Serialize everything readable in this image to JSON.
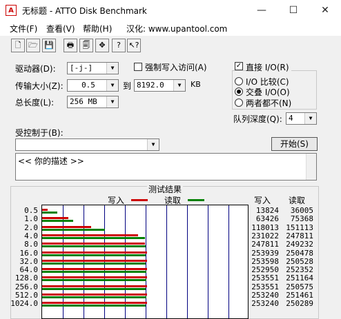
{
  "window": {
    "title": "无标题 - ATTO Disk Benchmark",
    "app_icon": "atto-disk-icon",
    "minimize": "—",
    "maximize": "☐",
    "close": "✕"
  },
  "menu": [
    "文件(F)",
    "查看(V)",
    "帮助(H)",
    "汉化: www.upantool.com"
  ],
  "toolbar_icons": [
    "new-file-icon",
    "open-folder-icon",
    "save-disk-icon",
    "print-icon",
    "print-preview-icon",
    "move-crosshair-icon",
    "help-icon",
    "context-help-icon"
  ],
  "toolbar_glyphs": [
    "🗋",
    "🗁",
    "💾",
    "🖶",
    "🗐",
    "✥",
    "?",
    "↖?"
  ],
  "form": {
    "drive_label": "驱动器(D):",
    "drive_value": "[-j-]",
    "force_write_label": "强制写入访问(A)",
    "force_write_checked": false,
    "transfer_label": "传输大小(Z):",
    "transfer_from": "0.5",
    "transfer_to_label": "到",
    "transfer_to": "8192.0",
    "transfer_unit": "KB",
    "total_label": "总长度(L):",
    "total_value": "256 MB",
    "direct_io_label": "直接 I/O(R)",
    "direct_io_checked": true,
    "io_compare_label": "I/O 比较(C)",
    "overlapped_io_label": "交叠 I/O(O)",
    "neither_label": "两者都不(N)",
    "selected_io_mode": "overlapped",
    "queue_label": "队列深度(Q):",
    "queue_value": "4",
    "controlled_by_label": "受控制于(B):",
    "controlled_by_value": "",
    "start_button": "开始(S)",
    "description": "<<   你的描述    >>"
  },
  "results": {
    "group_title": "测试结果",
    "write_legend": "写入",
    "read_legend": "读取",
    "write_color": "#cc0000",
    "read_color": "#008000",
    "col_write": "写入",
    "col_read": "读取"
  },
  "chart_data": {
    "type": "bar",
    "orientation": "horizontal",
    "categories": [
      "0.5",
      "1.0",
      "2.0",
      "4.0",
      "8.0",
      "16.0",
      "32.0",
      "64.0",
      "128.0",
      "256.0",
      "512.0",
      "1024.0"
    ],
    "series": [
      {
        "name": "写入",
        "values": [
          13824,
          63426,
          118013,
          231022,
          247811,
          253939,
          253598,
          252950,
          253551,
          253551,
          253240,
          253240
        ]
      },
      {
        "name": "读取",
        "values": [
          36005,
          75368,
          151113,
          247811,
          249232,
          250478,
          250528,
          252352,
          251164,
          250575,
          251461,
          250289
        ]
      }
    ],
    "xlim": [
      0,
      500000
    ],
    "grid": true
  }
}
